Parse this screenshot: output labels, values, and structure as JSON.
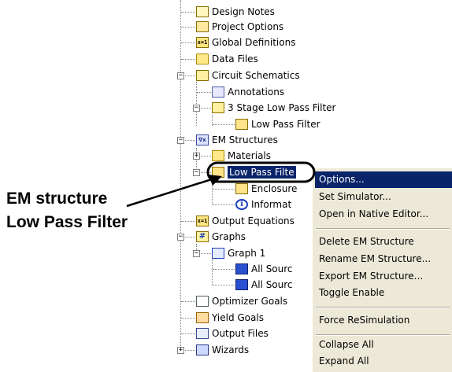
{
  "tree": {
    "items": [
      {
        "label": "Design Notes",
        "icon": "design-notes-icon"
      },
      {
        "label": "Project Options",
        "icon": "project-options-icon"
      },
      {
        "label": "Global Definitions",
        "icon": "global-definitions-icon"
      },
      {
        "label": "Data Files",
        "icon": "folder-icon"
      },
      {
        "label": "Circuit Schematics",
        "icon": "circuit-schematics-icon"
      },
      {
        "label": "Annotations",
        "icon": "annotations-icon"
      },
      {
        "label": "3 Stage Low Pass Filter",
        "icon": "schematic-icon"
      },
      {
        "label": "Low Pass Filter",
        "icon": "em-link-icon"
      },
      {
        "label": "EM Structures",
        "icon": "em-structures-icon"
      },
      {
        "label": "Materials",
        "icon": "materials-icon"
      },
      {
        "label": "Low Pass Filte",
        "icon": "em-structure-icon"
      },
      {
        "label": "Enclosure",
        "icon": "enclosure-icon"
      },
      {
        "label": "Informat",
        "icon": "info-icon"
      },
      {
        "label": "Output Equations",
        "icon": "output-equations-icon"
      },
      {
        "label": "Graphs",
        "icon": "graphs-icon"
      },
      {
        "label": "Graph 1",
        "icon": "graph-icon"
      },
      {
        "label": "All Sourc",
        "icon": "measurement-icon"
      },
      {
        "label": "All Sourc",
        "icon": "measurement-icon"
      },
      {
        "label": "Optimizer Goals",
        "icon": "optimizer-goals-icon"
      },
      {
        "label": "Yield Goals",
        "icon": "yield-goals-icon"
      },
      {
        "label": "Output Files",
        "icon": "output-files-icon"
      },
      {
        "label": "Wizards",
        "icon": "wizards-icon"
      }
    ],
    "expand_glyphs": {
      "minus": "−",
      "plus": "+"
    },
    "icon_glyphs": {
      "xeq": "x=1",
      "em": "∇x",
      "info": "i",
      "graphs": "#"
    }
  },
  "context_menu": {
    "items": [
      "Options...",
      "Set Simulator...",
      "Open in Native Editor...",
      "Delete EM Structure",
      "Rename EM Structure...",
      "Export EM Structure...",
      "Toggle Enable",
      "Force ReSimulation",
      "Collapse All",
      "Expand All"
    ],
    "highlighted": "Options..."
  },
  "callout": {
    "line1": "EM structure",
    "line2": "Low Pass Filter"
  },
  "colors": {
    "selection": "#0a246a",
    "menu_bg": "#ece9d8"
  }
}
